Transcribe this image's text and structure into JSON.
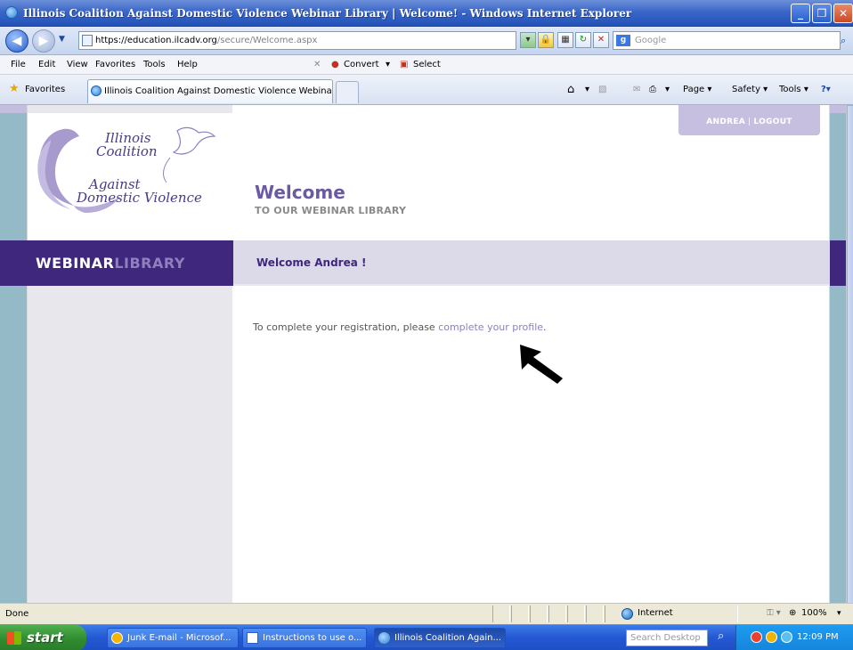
{
  "window": {
    "title": "Illinois Coalition Against Domestic Violence Webinar Library | Welcome! - Windows Internet Explorer"
  },
  "address": {
    "scheme": "https://",
    "host": "education.ilcadv.org",
    "path": "/secure/Welcome.aspx",
    "search_placeholder": "Google"
  },
  "menu": {
    "file": "File",
    "edit": "Edit",
    "view": "View",
    "favorites": "Favorites",
    "tools": "Tools",
    "help": "Help",
    "convert": "Convert",
    "select": "Select"
  },
  "favbar": {
    "favorites": "Favorites",
    "tab_title": "Illinois Coalition Against Domestic Violence Webinar Lib...",
    "page": "Page",
    "safety": "Safety",
    "tools": "Tools"
  },
  "site": {
    "logo_lines": [
      "Illinois",
      "Coalition",
      "Against",
      "Domestic Violence"
    ],
    "user": "ANDREA",
    "logout": "LOGOUT",
    "welcome": "Welcome",
    "subtitle": "TO OUR WEBINAR LIBRARY",
    "brand_a": "WEBINAR",
    "brand_b": "LIBRARY",
    "greeting": "Welcome Andrea !",
    "message_pre": "To complete your registration, please ",
    "message_link": "complete your profile",
    "message_post": "."
  },
  "status": {
    "left": "Done",
    "zone": "Internet",
    "zoom": "100%"
  },
  "taskbar": {
    "start": "start",
    "items": [
      "Junk E-mail - Microsof...",
      "Instructions to use o...",
      "Illinois Coalition Again..."
    ],
    "search": "Search Desktop",
    "clock": "12:09 PM"
  },
  "colors": {
    "brand_purple": "#3e277c",
    "accent_lilac": "#8b7fc0",
    "title_blue": "#2352b8"
  }
}
